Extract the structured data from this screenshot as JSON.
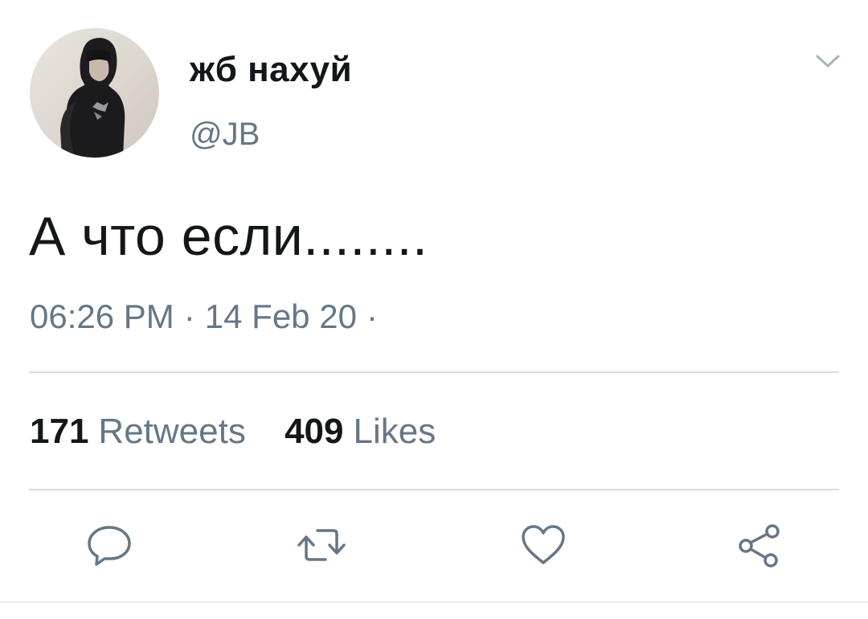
{
  "tweet": {
    "display_name": "жб нахуй",
    "handle": "@JB",
    "text": "А что если........",
    "time": "06:26 PM",
    "date": "14 Feb 20",
    "separator": "·",
    "retweets_count": "171",
    "retweets_label": "Retweets",
    "likes_count": "409",
    "likes_label": "Likes"
  },
  "icons": {
    "more": "chevron-down-icon",
    "reply": "reply-icon",
    "retweet": "retweet-icon",
    "like": "heart-icon",
    "share": "share-icon"
  },
  "colors": {
    "text_primary": "#14171a",
    "text_secondary": "#657786",
    "divider": "#d6dee4",
    "icon": "#657786"
  }
}
